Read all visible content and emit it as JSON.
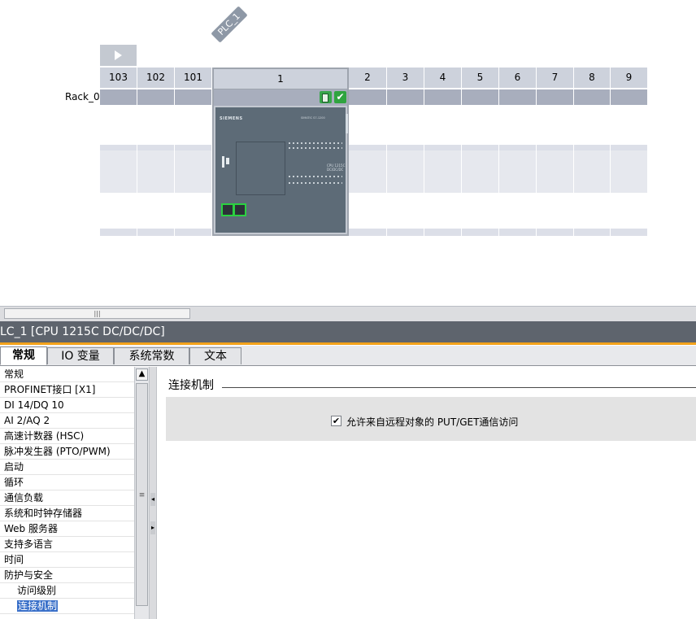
{
  "rack": {
    "device_tag": "PLC_1",
    "rack_name": "Rack_0",
    "slots": [
      "103",
      "102",
      "101",
      "1",
      "2",
      "3",
      "4",
      "5",
      "6",
      "7",
      "8",
      "9"
    ],
    "cpu": {
      "brand": "SIEMENS",
      "model": "SIMATIC S7-1200",
      "type_label_line1": "CPU 1215C",
      "type_label_line2": "DC/DC/DC"
    }
  },
  "inspector": {
    "title": "LC_1 [CPU 1215C DC/DC/DC]",
    "tabs": [
      "常规",
      "IO 变量",
      "系统常数",
      "文本"
    ],
    "active_tab": "常规",
    "nav_items": [
      {
        "label": "常规"
      },
      {
        "label": "PROFINET接口 [X1]"
      },
      {
        "label": "DI 14/DQ 10"
      },
      {
        "label": "AI 2/AQ 2"
      },
      {
        "label": "高速计数器 (HSC)"
      },
      {
        "label": "脉冲发生器 (PTO/PWM)"
      },
      {
        "label": "启动"
      },
      {
        "label": "循环"
      },
      {
        "label": "通信负载"
      },
      {
        "label": "系统和时钟存储器"
      },
      {
        "label": "Web 服务器"
      },
      {
        "label": "支持多语言"
      },
      {
        "label": "时间"
      },
      {
        "label": "防护与安全"
      },
      {
        "label": "访问级别"
      },
      {
        "label": "连接机制"
      }
    ],
    "selected_nav": "连接机制",
    "section_title": "连接机制",
    "checkbox": {
      "label": "允许来自远程对象的 PUT/GET通信访问",
      "checked": true
    }
  },
  "colors": {
    "accent_orange": "#f3a21b",
    "title_bar": "#5e646d",
    "selection": "#3a70c9",
    "status_green": "#2fa43f"
  }
}
